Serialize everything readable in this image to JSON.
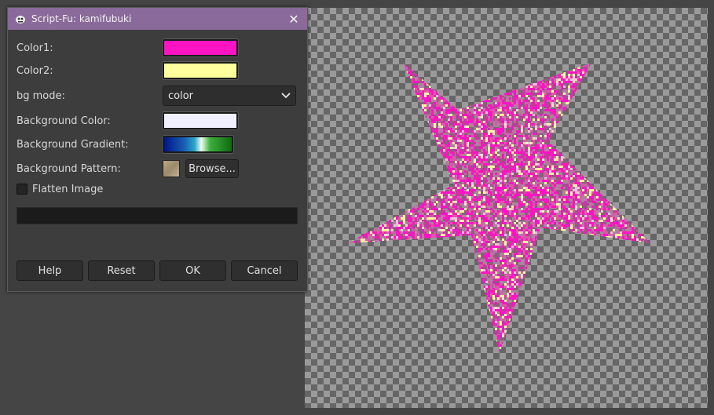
{
  "dialog": {
    "title": "Script-Fu: kamifubuki",
    "close_glyph": "✕",
    "fields": {
      "color1_label": "Color1:",
      "color1_value": "#ff14c4",
      "color2_label": "Color2:",
      "color2_value": "#ffff9e",
      "bg_mode_label": "bg mode:",
      "bg_mode_value": "color",
      "bg_color_label": "Background Color:",
      "bg_color_value": "#f0f0ff",
      "bg_gradient_label": "Background Gradient:",
      "bg_pattern_label": "Background Pattern:",
      "browse_label": "Browse...",
      "flatten_label": "Flatten Image"
    },
    "buttons": {
      "help": "Help",
      "reset": "Reset",
      "ok": "OK",
      "cancel": "Cancel"
    }
  },
  "canvas": {
    "star_colors": [
      "#ff14c4",
      "#ffff9e",
      "#d85aa8",
      "#f2c0e0",
      "#e040b0",
      "#ffe9b0"
    ]
  }
}
